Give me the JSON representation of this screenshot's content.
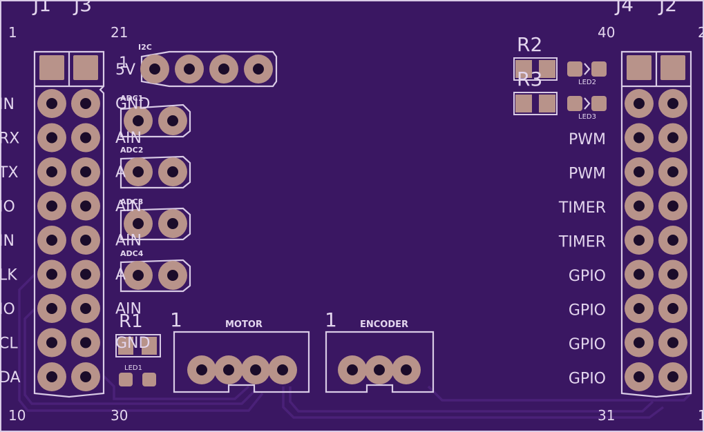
{
  "colors": {
    "board": "#3a1762",
    "trace": "#4a2178",
    "silkscreen": "#e3d6ee",
    "pad": "#b8938a",
    "drill": "#1b0c2a"
  },
  "headers": {
    "left_labels": [
      "J1",
      "J3"
    ],
    "right_labels": [
      "J4",
      "J2"
    ],
    "pin_numbers": {
      "top_left_a": "1",
      "top_left_b": "21",
      "top_right_a": "40",
      "top_right_b": "2",
      "bottom_left_a": "10",
      "bottom_left_b": "30",
      "bottom_right_a": "31",
      "bottom_right_b": "1"
    },
    "left_side_fragments": [
      "IN",
      "RX",
      "TX",
      "IO",
      "IN",
      "LK",
      "IO",
      "CL",
      "DA"
    ],
    "inner_left_labels": [
      "5V",
      "GND",
      "AIN",
      "A",
      "AIN",
      "AIN",
      "A",
      "AIN",
      "GND"
    ],
    "right_labels_list": [
      "PWM",
      "PWM",
      "TIMER",
      "TIMER",
      "GPIO",
      "GPIO",
      "GPIO",
      "GPIO"
    ]
  },
  "connectors": {
    "i2c": {
      "label": "I2C",
      "pin1": "1"
    },
    "adc": [
      "ADC1",
      "ADC2",
      "ADC3",
      "ADC4"
    ],
    "motor": {
      "label": "MOTOR",
      "pin1": "1"
    },
    "encoder": {
      "label": "ENCODER",
      "pin1": "1"
    }
  },
  "components": {
    "r1": "R1",
    "r2": "R2",
    "r3": "R3",
    "led1": "LED1",
    "led2": "LED2",
    "led3": "LED3"
  }
}
